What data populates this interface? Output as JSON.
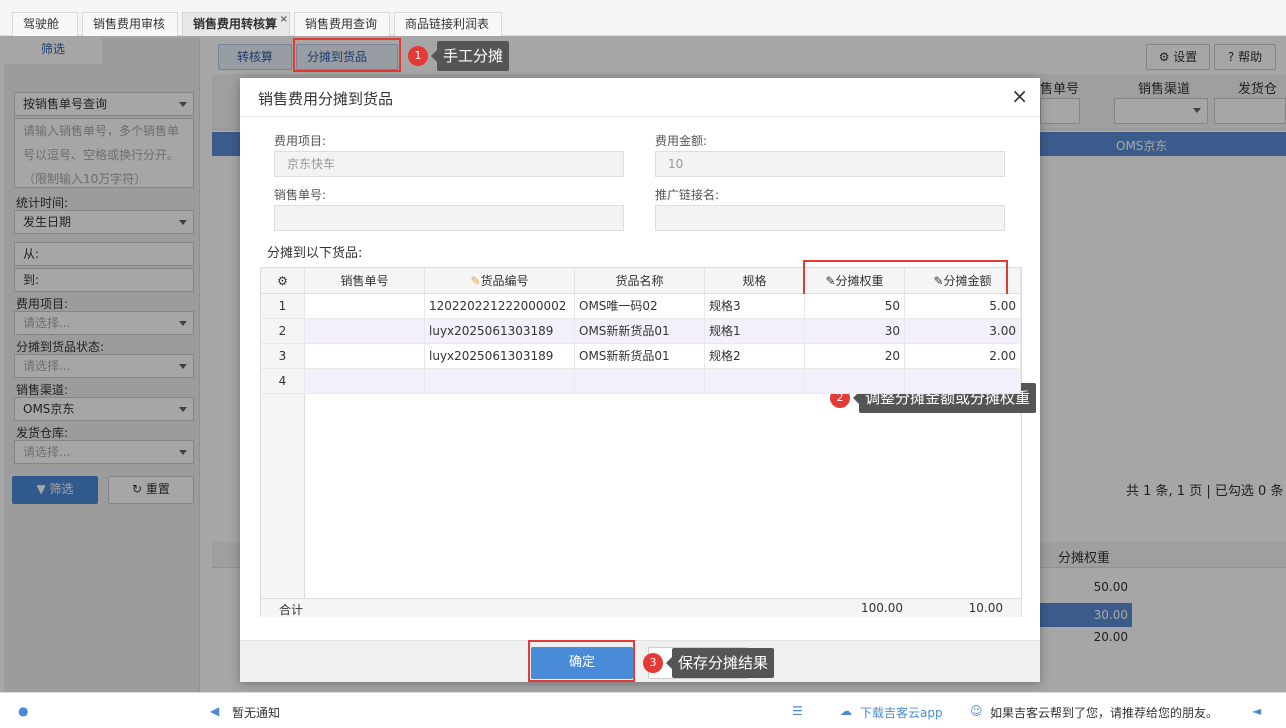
{
  "tabs": [
    {
      "label": "驾驶舱"
    },
    {
      "label": "销售费用审核"
    },
    {
      "label": "销售费用转核算",
      "close": "×"
    },
    {
      "label": "销售费用查询"
    },
    {
      "label": "商品链接利润表"
    }
  ],
  "sidebar": {
    "title": "筛选",
    "query_type": "按销售单号查询",
    "order_placeholder": "请输入销售单号，多个销售单号以逗号、空格或换行分开。（限制输入10万字符）",
    "stat_time_label": "统计时间:",
    "stat_time_value": "发生日期",
    "from_label": "从:",
    "to_label": "到:",
    "fee_item_label": "费用项目:",
    "fee_item_value": "请选择...",
    "alloc_status_label": "分摊到货品状态:",
    "alloc_status_value": "请选择...",
    "channel_label": "销售渠道:",
    "channel_value": "OMS京东",
    "warehouse_label": "发货仓库:",
    "warehouse_value": "请选择...",
    "filter_btn": "筛选",
    "reset_btn": "重置"
  },
  "toolbar": {
    "transfer_btn": "转核算",
    "alloc_btn": "分摊到货品",
    "settings_btn": "设置",
    "help_btn": "帮助"
  },
  "main": {
    "col_order": "售单号",
    "col_channel": "销售渠道",
    "col_warehouse": "发货仓库",
    "row_channel": "OMS京东",
    "pager": "共 1 条, 1 页 | 已勾选 0 条",
    "col_weight": "分摊权重",
    "weights": [
      "50.00",
      "30.00",
      "20.00"
    ]
  },
  "dialog": {
    "title": "销售费用分摊到货品",
    "close": "×",
    "fee_item_label": "费用项目:",
    "fee_item_value": "京东快车",
    "fee_amount_label": "费用金额:",
    "fee_amount_value": "10",
    "order_label": "销售单号:",
    "order_value": "",
    "promo_label": "推广链接名:",
    "promo_value": "",
    "section_label": "分摊到以下货品:",
    "columns": [
      "销售单号",
      "货品编号",
      "货品名称",
      "规格",
      "分摊权重",
      "分摊金额"
    ],
    "rows": [
      {
        "no": "1",
        "order": "",
        "code": "120220221222000002",
        "name": "OMS唯一码02",
        "spec": "规格3",
        "weight": "50",
        "amount": "5.00"
      },
      {
        "no": "2",
        "order": "",
        "code": "luyx2025061303189",
        "name": "OMS新新货品01",
        "spec": "规格1",
        "weight": "30",
        "amount": "3.00"
      },
      {
        "no": "3",
        "order": "",
        "code": "luyx2025061303189",
        "name": "OMS新新货品01",
        "spec": "规格2",
        "weight": "20",
        "amount": "2.00"
      },
      {
        "no": "4",
        "order": "",
        "code": "",
        "name": "",
        "spec": "",
        "weight": "",
        "amount": ""
      }
    ],
    "total_label": "合计",
    "total_weight": "100.00",
    "total_amount": "10.00",
    "ok_btn": "确定"
  },
  "callouts": [
    {
      "num": "1",
      "text": "手工分摊"
    },
    {
      "num": "2",
      "text": "调整分摊金额或分摊权重"
    },
    {
      "num": "3",
      "text": "保存分摊结果"
    }
  ],
  "statusbar": {
    "notice": "暂无通知",
    "download": "下载吉客云app",
    "recommend": "如果吉客云帮到了您，请推荐给您的朋友。"
  },
  "colors": {
    "accent": "#4a8bd8",
    "callout": "#e53935",
    "tooltip": "#555555"
  }
}
